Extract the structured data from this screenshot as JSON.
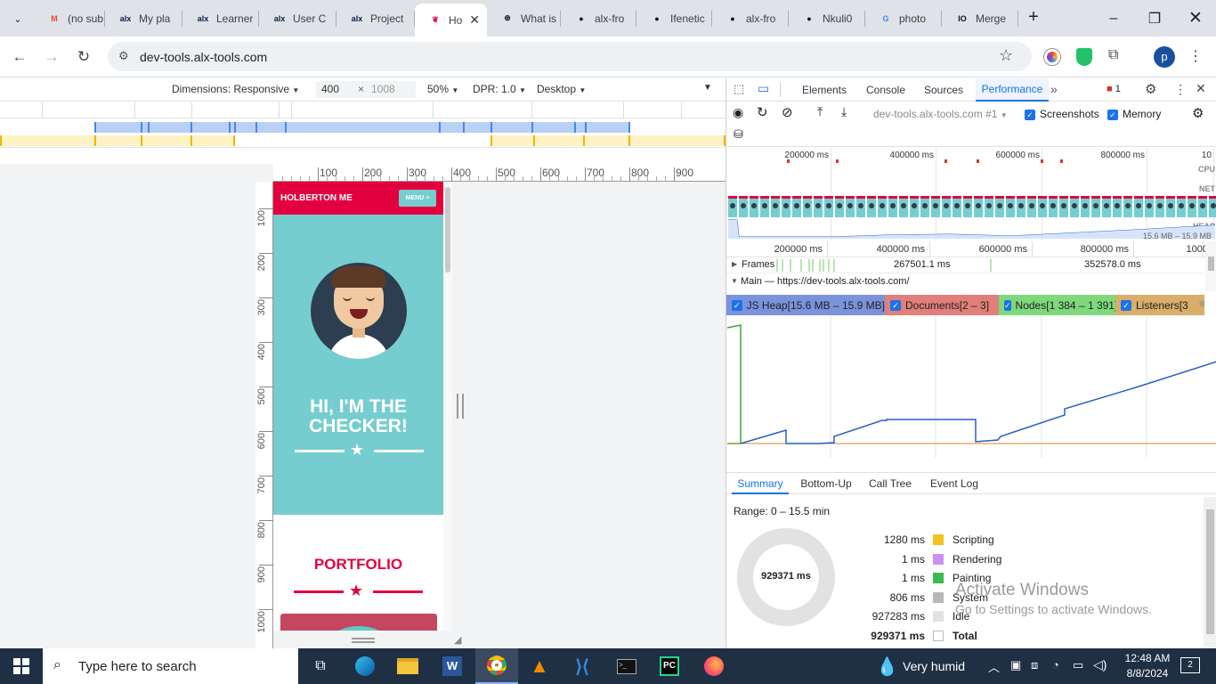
{
  "tabs": [
    {
      "label": "(no sub",
      "icon": "gmail-icon",
      "glyph": "M"
    },
    {
      "label": "My pla",
      "icon": "alx-icon",
      "glyph": "alx"
    },
    {
      "label": "Learner",
      "icon": "alx-icon",
      "glyph": "alx"
    },
    {
      "label": "User C",
      "icon": "alx-icon",
      "glyph": "alx"
    },
    {
      "label": "Project",
      "icon": "alx-icon",
      "glyph": "alx"
    },
    {
      "label": "Ho",
      "icon": "holberton-icon",
      "glyph": "❦"
    },
    {
      "label": "What is",
      "icon": "openai-icon",
      "glyph": "⊛"
    },
    {
      "label": "alx-fro",
      "icon": "github-icon",
      "glyph": "●"
    },
    {
      "label": "Ifenetic",
      "icon": "github-icon",
      "glyph": "●"
    },
    {
      "label": "alx-fro",
      "icon": "github-icon",
      "glyph": "●"
    },
    {
      "label": "Nkuli0",
      "icon": "github-icon",
      "glyph": "●"
    },
    {
      "label": "photo",
      "icon": "google-icon",
      "glyph": "G"
    },
    {
      "label": "Merge",
      "icon": "io-icon",
      "glyph": "IO"
    }
  ],
  "address": {
    "url": "dev-tools.alx-tools.com"
  },
  "profile": {
    "initial": "p"
  },
  "device_toolbar": {
    "dimensions": "Dimensions: Responsive",
    "width": "400",
    "times": "×",
    "height": "1008",
    "zoom": "50%",
    "dpr": "DPR: 1.0",
    "mode": "Desktop"
  },
  "ruler_h": [
    "100",
    "200",
    "300",
    "400",
    "500",
    "600",
    "700",
    "800",
    "900"
  ],
  "ruler_v": [
    "100",
    "200",
    "300",
    "400",
    "500",
    "600",
    "700",
    "800",
    "900",
    "1000"
  ],
  "mobile": {
    "brand": "HOLBERTON ME",
    "menu": "MENU ≡",
    "hero_title_1": "HI, I'M THE",
    "hero_title_2": "CHECKER!",
    "portfolio": "PORTFOLIO"
  },
  "devtools": {
    "tabs": [
      "Elements",
      "Console",
      "Sources",
      "Performance"
    ],
    "active_tab": "Performance",
    "more": "»",
    "issues_count": "1",
    "recording_select": "dev-tools.alx-tools.com #1",
    "screenshots": "Screenshots",
    "memory": "Memory",
    "overview_ticks": [
      "200000 ms",
      "400000 ms",
      "600000 ms",
      "800000 ms",
      "10"
    ],
    "lanes": [
      "CPU",
      "NET",
      "HEAP"
    ],
    "heap_range": "15.6 MB – 15.9 MB",
    "timeline_ticks": [
      "200000 ms",
      "400000 ms",
      "600000 ms",
      "800000 ms",
      "1000"
    ],
    "frames_label": "Frames",
    "frame_times": [
      "267501.1 ms",
      "352578.0 ms"
    ],
    "main_label": "Main — https://dev-tools.alx-tools.com/",
    "memory_legend": [
      {
        "label": "JS Heap[15.6 MB – 15.9 MB]",
        "color": "#7b93dc"
      },
      {
        "label": "Documents[2 – 3]",
        "color": "#e27f7a"
      },
      {
        "label": "Nodes[1 384 – 1 391]",
        "color": "#7fd97c"
      },
      {
        "label": "Listeners[3",
        "color": "#d9ad6a"
      }
    ],
    "bottom_tabs": [
      "Summary",
      "Bottom-Up",
      "Call Tree",
      "Event Log"
    ],
    "range": "Range: 0 – 15.5 min",
    "total_center": "929371 ms",
    "summary": [
      {
        "value": "1280 ms",
        "label": "Scripting",
        "color": "#f2c31e"
      },
      {
        "value": "1 ms",
        "label": "Rendering",
        "color": "#c891f2"
      },
      {
        "value": "1 ms",
        "label": "Painting",
        "color": "#3cb94f"
      },
      {
        "value": "806 ms",
        "label": "System",
        "color": "#b8b8b8"
      },
      {
        "value": "927283 ms",
        "label": "Idle",
        "color": "#e2e2e2"
      },
      {
        "value": "929371 ms",
        "label": "Total",
        "color": "#ffffff"
      }
    ]
  },
  "watermark": {
    "line1": "Activate Windows",
    "line2": "Go to Settings to activate Windows."
  },
  "taskbar": {
    "search_placeholder": "Type here to search",
    "weather": "Very humid",
    "time": "12:48 AM",
    "date": "8/8/2024",
    "notifications": "2"
  }
}
